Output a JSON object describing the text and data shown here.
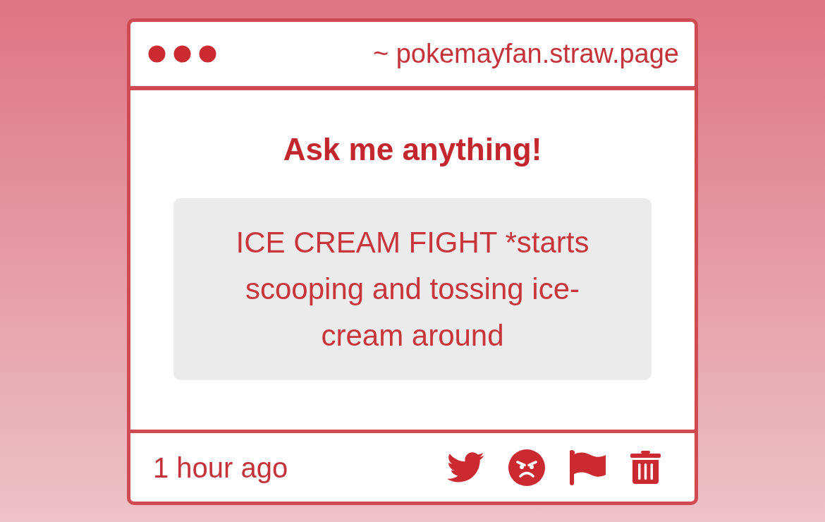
{
  "window": {
    "url": "~ pokemayfan.straw.page"
  },
  "title": "Ask me anything!",
  "question": "ICE CREAM FIGHT *starts scooping and tossing ice-cream around",
  "footer": {
    "time": "1 hour ago",
    "actions": [
      {
        "kind": "bird"
      },
      {
        "kind": "angry"
      },
      {
        "kind": "flag"
      },
      {
        "kind": "trash"
      }
    ]
  }
}
